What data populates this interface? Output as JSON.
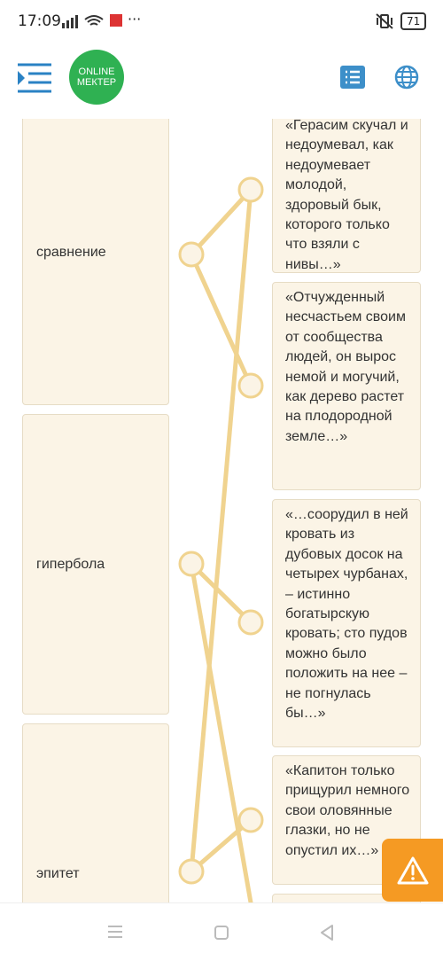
{
  "status": {
    "time": "17:09",
    "battery": "71",
    "more": "···"
  },
  "header": {
    "logo_line1": "ONLINE",
    "logo_line2": "МЕКТЕР"
  },
  "terms": [
    "сравнение",
    "гипербола",
    "эпитет"
  ],
  "quotes": [
    "«Герасим скучал и недоумевал, как недоумевает молодой, здоровый бык, которого только что взяли с нивы…»",
    "«Отчужденный несчастьем своим от сообщества людей, он вырос немой и могучий, как дерево растет на плодородной земле…»",
    "«…соорудил в ней кровать из дубовых досок на четырех чурбанах, – истинно богатырскую кровать; сто пудов можно было положить на нее – не погнулась бы…»",
    "«Капитон только прищурил немного свои оловянные глазки, но не опустил их…»"
  ],
  "colors": {
    "accent": "#f0d38f",
    "box_bg": "#fbf4e6",
    "warning": "#f59a23",
    "logo": "#2fb152"
  }
}
